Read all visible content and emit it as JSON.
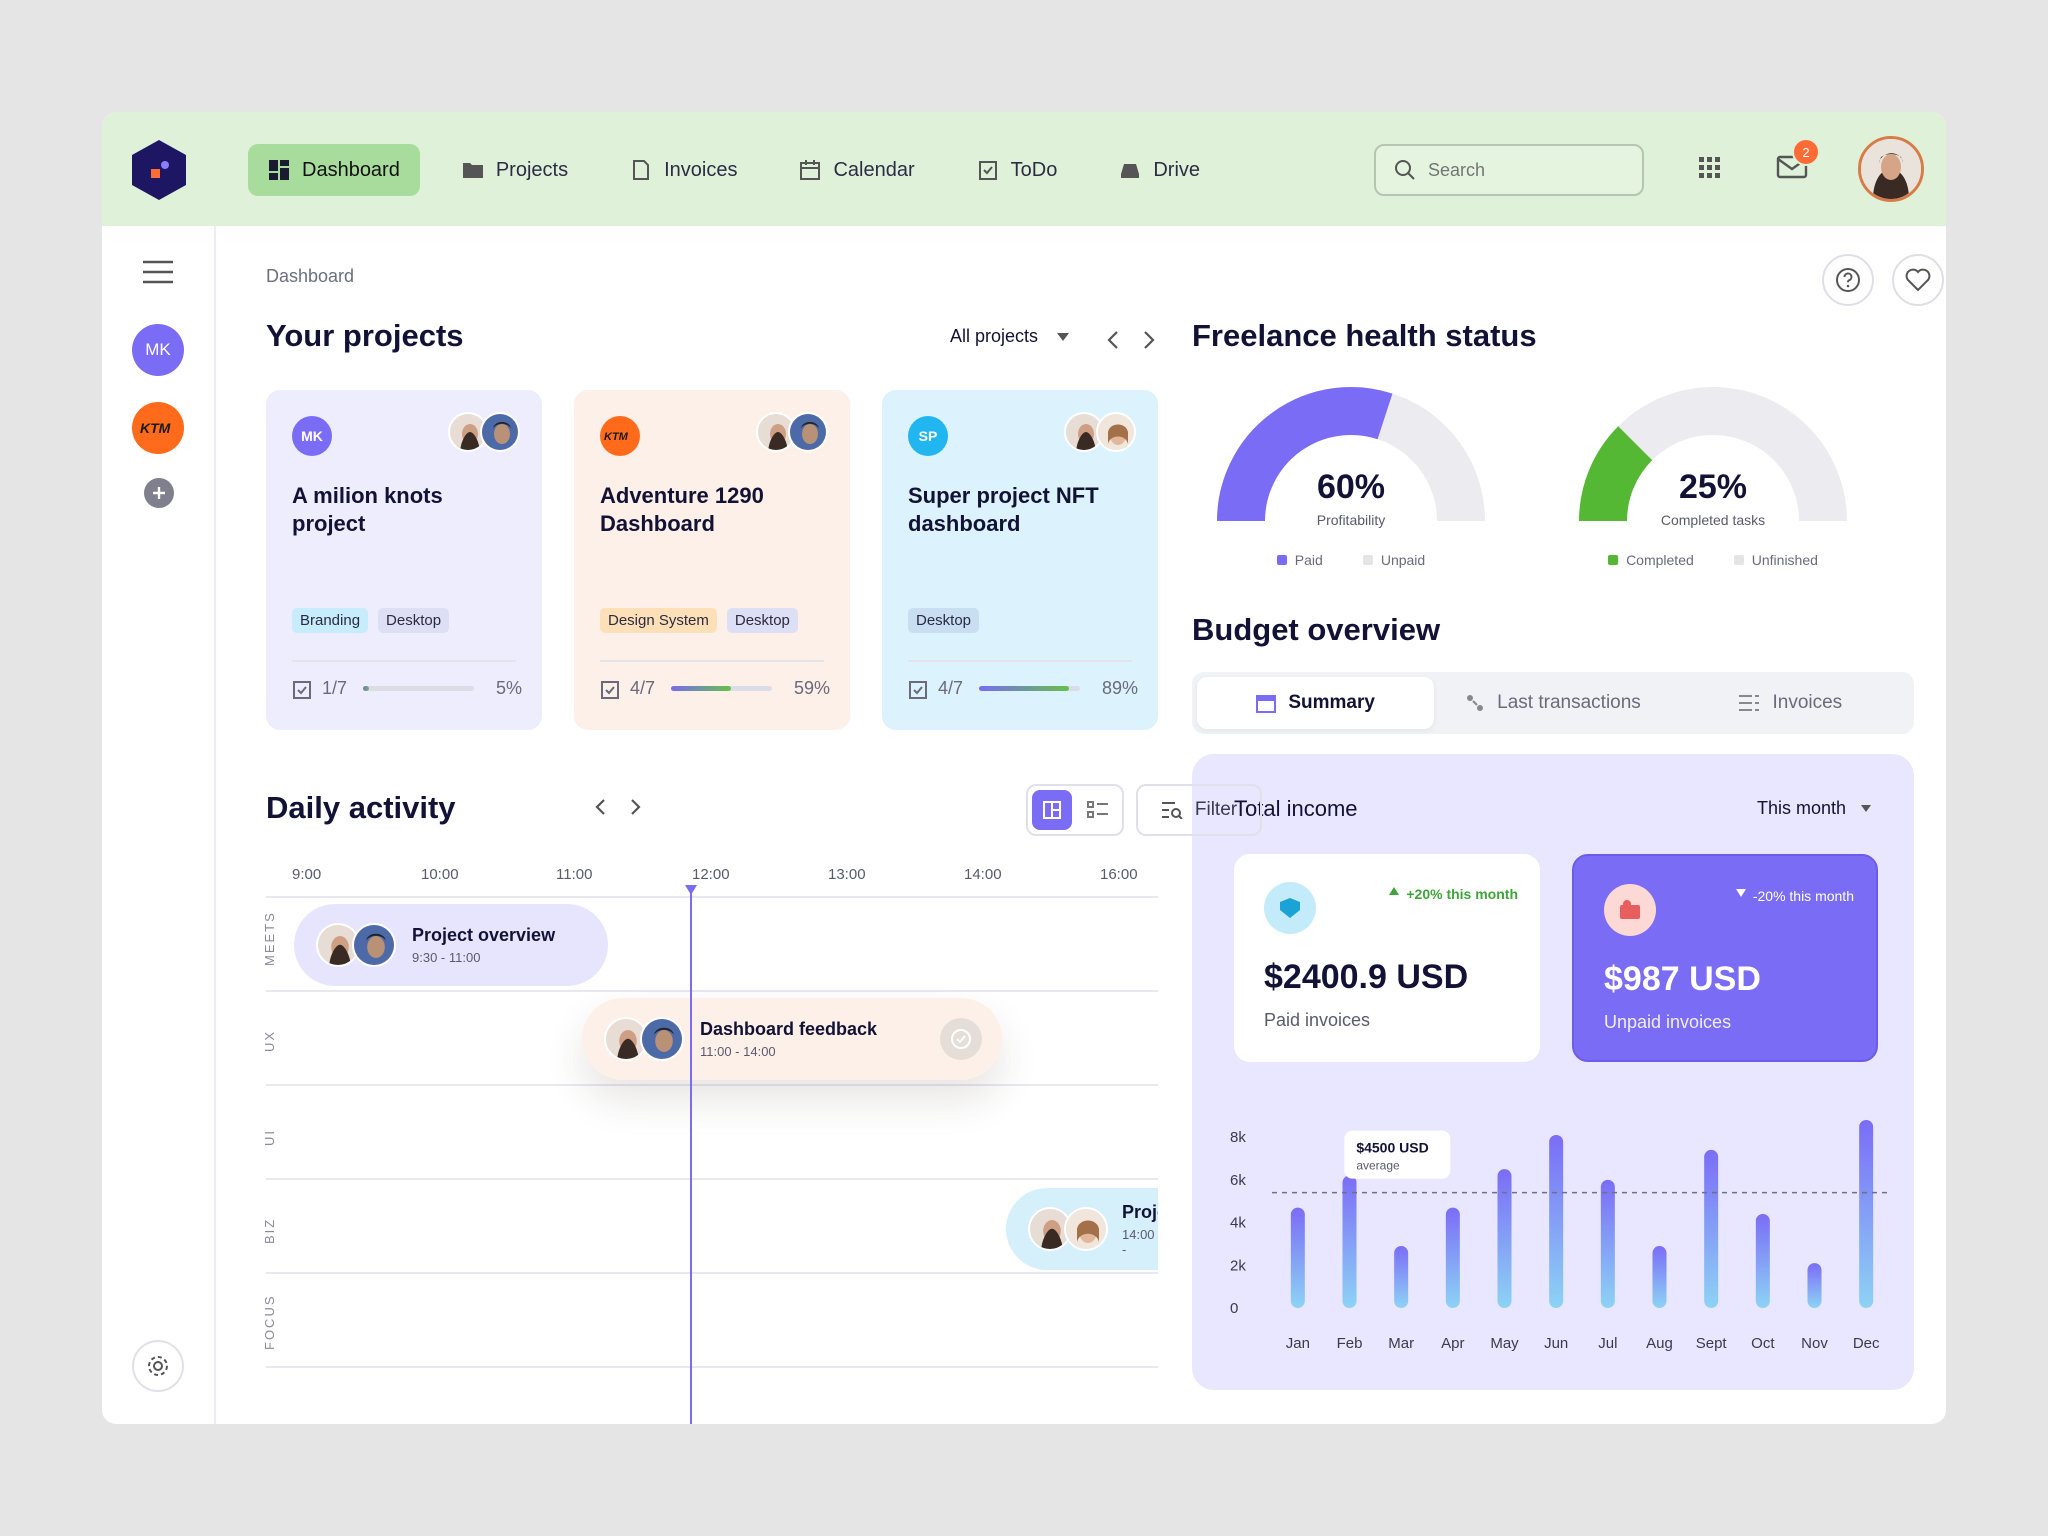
{
  "nav": {
    "items": [
      {
        "label": "Dashboard",
        "icon": "dashboard-icon",
        "active": true
      },
      {
        "label": "Projects",
        "icon": "folder-icon"
      },
      {
        "label": "Invoices",
        "icon": "document-icon"
      },
      {
        "label": "Calendar",
        "icon": "calendar-icon"
      },
      {
        "label": "ToDo",
        "icon": "checklist-icon"
      },
      {
        "label": "Drive",
        "icon": "drive-icon"
      }
    ],
    "search_placeholder": "Search",
    "mail_badge": "2"
  },
  "sidebar": {
    "workspace_initials": "MK",
    "brand_label": "KTM"
  },
  "breadcrumb": "Dashboard",
  "projects": {
    "heading": "Your projects",
    "filter_label": "All projects",
    "cards": [
      {
        "initials": "MK",
        "title": "A milion knots project",
        "tags": [
          "Branding",
          "Desktop"
        ],
        "tasks": "1/7",
        "percent": "5%",
        "progress": 0.05
      },
      {
        "initials": "KTM",
        "title": "Adventure 1290 Dashboard",
        "tags": [
          "Design System",
          "Desktop"
        ],
        "tasks": "4/7",
        "percent": "59%",
        "progress": 0.59
      },
      {
        "initials": "SP",
        "title": "Super project NFT dashboard",
        "tags": [
          "Desktop"
        ],
        "tasks": "4/7",
        "percent": "89%",
        "progress": 0.89
      }
    ]
  },
  "health": {
    "heading": "Freelance health status",
    "gauges": [
      {
        "value": "60%",
        "label": "Profitability",
        "fraction": 0.6,
        "color": "#7b6cf6",
        "legend": [
          "Paid",
          "Unpaid"
        ]
      },
      {
        "value": "25%",
        "label": "Completed tasks",
        "fraction": 0.25,
        "color": "#55b834",
        "legend": [
          "Completed",
          "Unfinished"
        ]
      }
    ]
  },
  "activity": {
    "heading": "Daily activity",
    "filter_label": "Filter",
    "hours": [
      "9:00",
      "10:00",
      "11:00",
      "12:00",
      "13:00",
      "14:00",
      "16:00"
    ],
    "lanes": [
      "MEETS",
      "UX",
      "UI",
      "BIZ",
      "FOCUS"
    ],
    "events": [
      {
        "title": "Project overview",
        "time": "9:30 - 11:00"
      },
      {
        "title": "Dashboard feedback",
        "time": "11:00 - 14:00"
      },
      {
        "title": "Proje",
        "time": "14:00 -"
      }
    ]
  },
  "budget": {
    "heading": "Budget overview",
    "tabs": [
      "Summary",
      "Last transactions",
      "Invoices"
    ],
    "income_title": "Total income",
    "period": "This month",
    "paid": {
      "change": "+20% this month",
      "amount": "$2400.9 USD",
      "label": "Paid invoices"
    },
    "unpaid": {
      "change": "-20% this month",
      "amount": "$987 USD",
      "label": "Unpaid invoices"
    },
    "tooltip": {
      "amount": "$4500 USD",
      "label": "average"
    }
  },
  "chart_data": {
    "type": "bar",
    "categories": [
      "Jan",
      "Feb",
      "Mar",
      "Apr",
      "May",
      "Jun",
      "Jul",
      "Aug",
      "Sept",
      "Oct",
      "Nov",
      "Dec"
    ],
    "values": [
      4700,
      6200,
      2900,
      4700,
      6500,
      8100,
      6000,
      2900,
      7400,
      4400,
      2100,
      8800
    ],
    "average": 5400,
    "yticks": [
      "8k",
      "6k",
      "4k",
      "2k",
      "0"
    ],
    "ylim": [
      0,
      8800
    ],
    "colors": {
      "top": "#7b6cf6",
      "bottom": "#8dd3f5"
    }
  }
}
